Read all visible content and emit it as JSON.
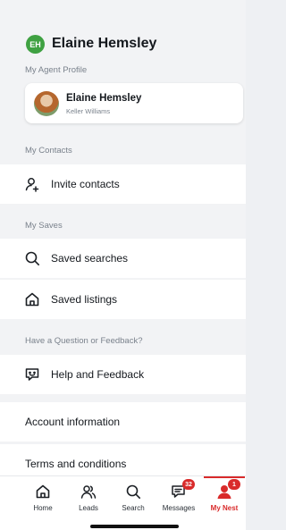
{
  "user": {
    "initials": "EH",
    "name": "Elaine Hemsley"
  },
  "sections": {
    "agent_profile": "My Agent Profile",
    "contacts": "My Contacts",
    "saves": "My Saves",
    "feedback": "Have a Question or Feedback?"
  },
  "agent": {
    "name": "Elaine Hemsley",
    "brokerage": "Keller Williams"
  },
  "menu": {
    "invite_contacts": "Invite contacts",
    "saved_searches": "Saved searches",
    "saved_listings": "Saved listings",
    "help_feedback": "Help and Feedback",
    "account_information": "Account information",
    "terms": "Terms and conditions"
  },
  "tabs": [
    {
      "label": "Home",
      "icon": "home-icon"
    },
    {
      "label": "Leads",
      "icon": "people-icon"
    },
    {
      "label": "Search",
      "icon": "search-icon"
    },
    {
      "label": "Messages",
      "icon": "messages-icon",
      "badge": "32"
    },
    {
      "label": "My Nest",
      "icon": "profile-icon",
      "badge": "1",
      "active": true
    }
  ],
  "colors": {
    "accent": "#d92b2b",
    "avatar": "#3fa142"
  }
}
